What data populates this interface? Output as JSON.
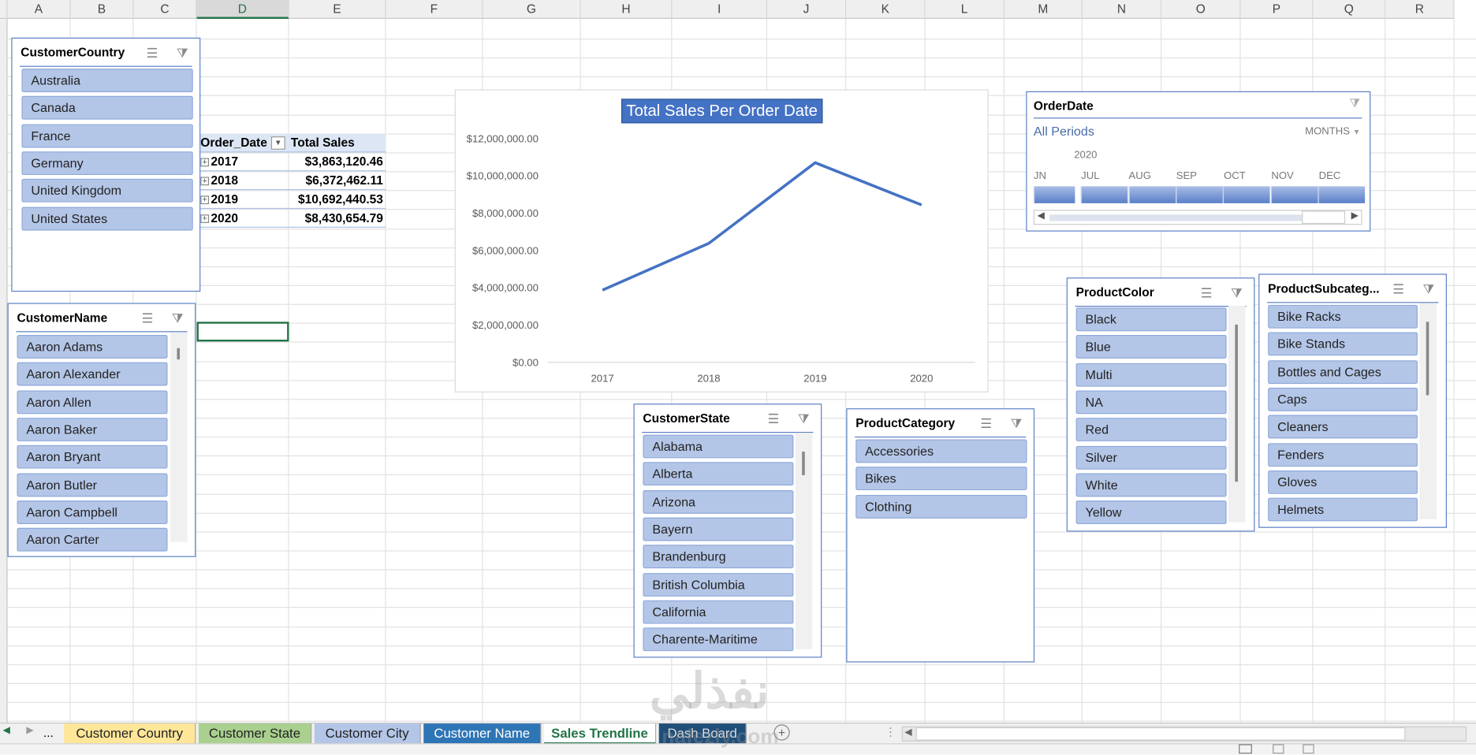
{
  "columns": [
    "A",
    "B",
    "C",
    "D",
    "E",
    "F",
    "G",
    "H",
    "I",
    "J",
    "K",
    "L",
    "M",
    "N",
    "O",
    "P",
    "Q",
    "R"
  ],
  "selected_column": "D",
  "pivot": {
    "headers": [
      "Order_Date",
      "Total Sales"
    ],
    "rows": [
      [
        "2017",
        "$3,863,120.46"
      ],
      [
        "2018",
        "$6,372,462.11"
      ],
      [
        "2019",
        "$10,692,440.53"
      ],
      [
        "2020",
        "$8,430,654.79"
      ]
    ]
  },
  "slicers": {
    "country": {
      "title": "CustomerCountry",
      "items": [
        "Australia",
        "Canada",
        "France",
        "Germany",
        "United Kingdom",
        "United States"
      ]
    },
    "name": {
      "title": "CustomerName",
      "items": [
        "Aaron Adams",
        "Aaron Alexander",
        "Aaron Allen",
        "Aaron Baker",
        "Aaron Bryant",
        "Aaron Butler",
        "Aaron Campbell",
        "Aaron Carter"
      ]
    },
    "state": {
      "title": "CustomerState",
      "items": [
        "Alabama",
        "Alberta",
        "Arizona",
        "Bayern",
        "Brandenburg",
        "British Columbia",
        "California",
        "Charente-Maritime"
      ]
    },
    "category": {
      "title": "ProductCategory",
      "items": [
        "Accessories",
        "Bikes",
        "Clothing"
      ]
    },
    "color": {
      "title": "ProductColor",
      "items": [
        "Black",
        "Blue",
        "Multi",
        "NA",
        "Red",
        "Silver",
        "White",
        "Yellow"
      ]
    },
    "subcategory": {
      "title": "ProductSubcateg...",
      "items": [
        "Bike Racks",
        "Bike Stands",
        "Bottles and Cages",
        "Caps",
        "Cleaners",
        "Fenders",
        "Gloves",
        "Helmets"
      ]
    }
  },
  "timeline": {
    "title": "OrderDate",
    "period": "All Periods",
    "level": "MONTHS",
    "year": "2020",
    "months": [
      "JN",
      "JUL",
      "AUG",
      "SEP",
      "OCT",
      "NOV",
      "DEC"
    ]
  },
  "chart_data": {
    "type": "line",
    "title": "Total Sales Per Order Date",
    "categories": [
      "2017",
      "2018",
      "2019",
      "2020"
    ],
    "values": [
      3863120.46,
      6372462.11,
      10692440.53,
      8430654.79
    ],
    "yticks": [
      "$0.00",
      "$2,000,000.00",
      "$4,000,000.00",
      "$6,000,000.00",
      "$8,000,000.00",
      "$10,000,000.00",
      "$12,000,000.00"
    ],
    "ylim": [
      0,
      12000000
    ],
    "color": "#4472c4"
  },
  "tabs": {
    "more": "...",
    "items": [
      {
        "label": "Customer Country",
        "bg": "#ffe699",
        "fg": "#222"
      },
      {
        "label": "Customer State",
        "bg": "#a9d08e",
        "fg": "#222"
      },
      {
        "label": "Customer City",
        "bg": "#b4c6e7",
        "fg": "#222"
      },
      {
        "label": "Customer Name",
        "bg": "#2e75b6",
        "fg": "#fff"
      },
      {
        "label": "Sales Trendline",
        "bg": "#ffffff",
        "fg": "#217346",
        "active": true
      },
      {
        "label": "Dash Board",
        "bg": "#1f4e79",
        "fg": "#ddd"
      }
    ]
  },
  "watermark": {
    "arabic": "نفذلي",
    "latin": "nafezly.com"
  }
}
